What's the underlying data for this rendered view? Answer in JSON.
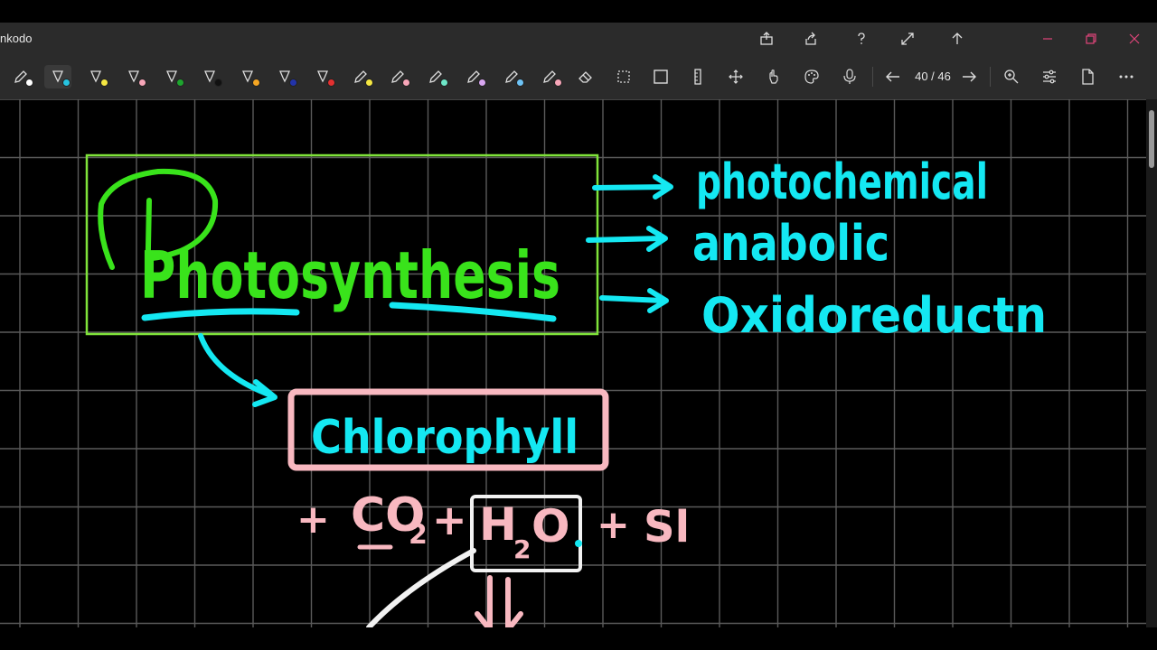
{
  "app": {
    "title": "nkodo"
  },
  "page": {
    "current": "40",
    "total": "46",
    "counter": "40 / 46"
  },
  "colors": {
    "green": "#39e31b",
    "frame_green": "#7fe33a",
    "cyan": "#14e8f2",
    "pink": "#f8b8c0",
    "white": "#f2f2f2",
    "grid": "#5a5a5a"
  },
  "pen_colors": [
    "#27c3e0",
    "#f5e742",
    "#f7a6b8",
    "#1ea52e",
    "#111111",
    "#f5a623",
    "#2233aa",
    "#e33030",
    "#f5e742",
    "#f7a6b8",
    "#6ee7c8",
    "#d8a6f0",
    "#6ec3f5",
    "#f7a6b8"
  ],
  "canvas": {
    "main_word": "Photosynthesis",
    "branches": [
      "photochemical",
      "anabolic",
      "Oxidoreductn"
    ],
    "pigment": "Chlorophyll",
    "equation": {
      "lead": "+",
      "co": "CO",
      "co_sub": "2",
      "plus1": "+",
      "h": "H",
      "h_sub": "2",
      "o": "O",
      "plus2": "+",
      "tail": "Sl"
    }
  }
}
